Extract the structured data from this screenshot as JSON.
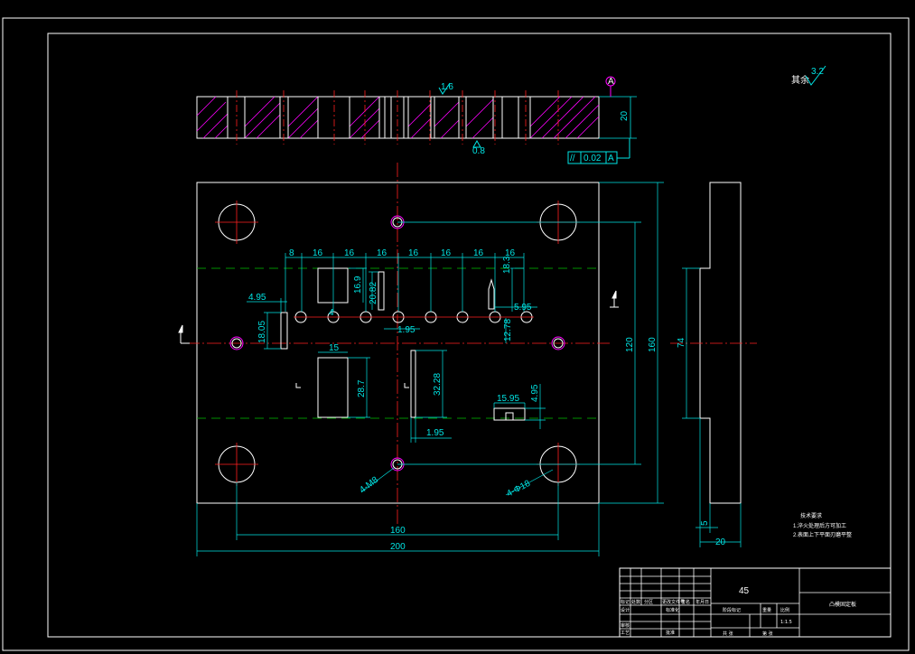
{
  "colors": {
    "background": "#000000",
    "outline": "#ffffff",
    "dimension": "#00e5e5",
    "centerline": "#ff2020",
    "hidden_line": "#00c000",
    "hatch": "#ff00ff"
  },
  "section_view": {
    "datum_label": "A",
    "thickness_label": "20",
    "roughness_label": "1.6",
    "roughness_label_2": "0.8",
    "tolerance_symbol": "//",
    "tolerance_value": "0.02",
    "tolerance_datum": "A"
  },
  "top_note": {
    "label": "其余",
    "value": "3.2"
  },
  "plan_view": {
    "hole_spacing_labels": [
      "8",
      "16",
      "16",
      "16",
      "16",
      "16",
      "16",
      "16"
    ],
    "dims": {
      "d_4_95": "4.95",
      "d_18_05": "18.05",
      "d_4": "4",
      "d_16_9": "16.9",
      "d_20_82": "20.82",
      "d_1_95a": "1.95",
      "d_18_3": "18.3",
      "d_5_95": "5.95",
      "d_12_78": "12.78",
      "d_15": "15",
      "d_28_7": "28.7",
      "d_32_28": "32.28",
      "d_1_95b": "1.95",
      "d_15_95": "15.95",
      "d_4_95b": "4.95",
      "d_120": "120",
      "d_160v": "160",
      "d_160h": "160",
      "d_200": "200",
      "hole_m8": "4-M8",
      "hole_d18": "4-Φ18"
    }
  },
  "side_view": {
    "height_label": "74",
    "offset_label": "5",
    "width_label": "20"
  },
  "tech_notes": {
    "title": "技术要求",
    "items": [
      "1.淬火处理后方可加工",
      "2.表面上下平面刃磨平整"
    ]
  },
  "title_block": {
    "material": "45",
    "part_name": "凸模固定板",
    "scale": "1:1.5",
    "headers_row1": [
      "标记",
      "处数",
      "分区",
      "更改文件号",
      "签名",
      "年月日"
    ],
    "headers_row2": [
      "设计",
      "",
      "标准化"
    ],
    "headers_row3": [
      "审核",
      ""
    ],
    "headers_row4": [
      "工艺",
      "",
      "批准"
    ],
    "stage_label": "阶段标记",
    "weight_label": "重量",
    "scale_label": "比例",
    "sheets_label": "共 张",
    "sheet_label": "第 张"
  }
}
